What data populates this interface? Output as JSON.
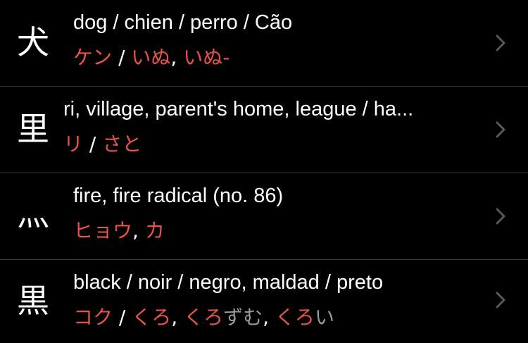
{
  "colors": {
    "background": "#000000",
    "separator": "#3a3a3c",
    "reading": "#e8534a",
    "okurigana": "#98989d",
    "text": "#ffffff",
    "chevron": "#5a5a5e"
  },
  "rows": [
    {
      "kanji": "犬",
      "meaning": "dog / chien / perro / Cão",
      "readings": [
        {
          "t": "ケン",
          "c": "r"
        },
        {
          "t": " / ",
          "c": "p"
        },
        {
          "t": "いぬ",
          "c": "r"
        },
        {
          "t": ", ",
          "c": "p"
        },
        {
          "t": "いぬ-",
          "c": "r"
        }
      ],
      "chevron": "chevron-right-icon"
    },
    {
      "kanji": "里",
      "meaning": "ri, village, parent's home, league / ha...",
      "readings": [
        {
          "t": "リ",
          "c": "r"
        },
        {
          "t": " / ",
          "c": "p"
        },
        {
          "t": "さと",
          "c": "r"
        }
      ],
      "chevron": "chevron-right-icon"
    },
    {
      "kanji": "灬",
      "meaning": "fire, fire radical (no. 86)",
      "readings": [
        {
          "t": "ヒョウ",
          "c": "r"
        },
        {
          "t": ", ",
          "c": "p"
        },
        {
          "t": "カ",
          "c": "r"
        }
      ],
      "chevron": "chevron-right-icon"
    },
    {
      "kanji": "黒",
      "meaning": "black / noir / negro, maldad / preto",
      "readings": [
        {
          "t": "コク",
          "c": "r"
        },
        {
          "t": " / ",
          "c": "p"
        },
        {
          "t": "くろ",
          "c": "r"
        },
        {
          "t": ", ",
          "c": "p"
        },
        {
          "t": "くろ",
          "c": "r"
        },
        {
          "t": "ずむ",
          "c": "g"
        },
        {
          "t": ", ",
          "c": "p"
        },
        {
          "t": "くろ",
          "c": "r"
        },
        {
          "t": "い",
          "c": "g"
        }
      ],
      "chevron": "chevron-right-icon"
    }
  ]
}
